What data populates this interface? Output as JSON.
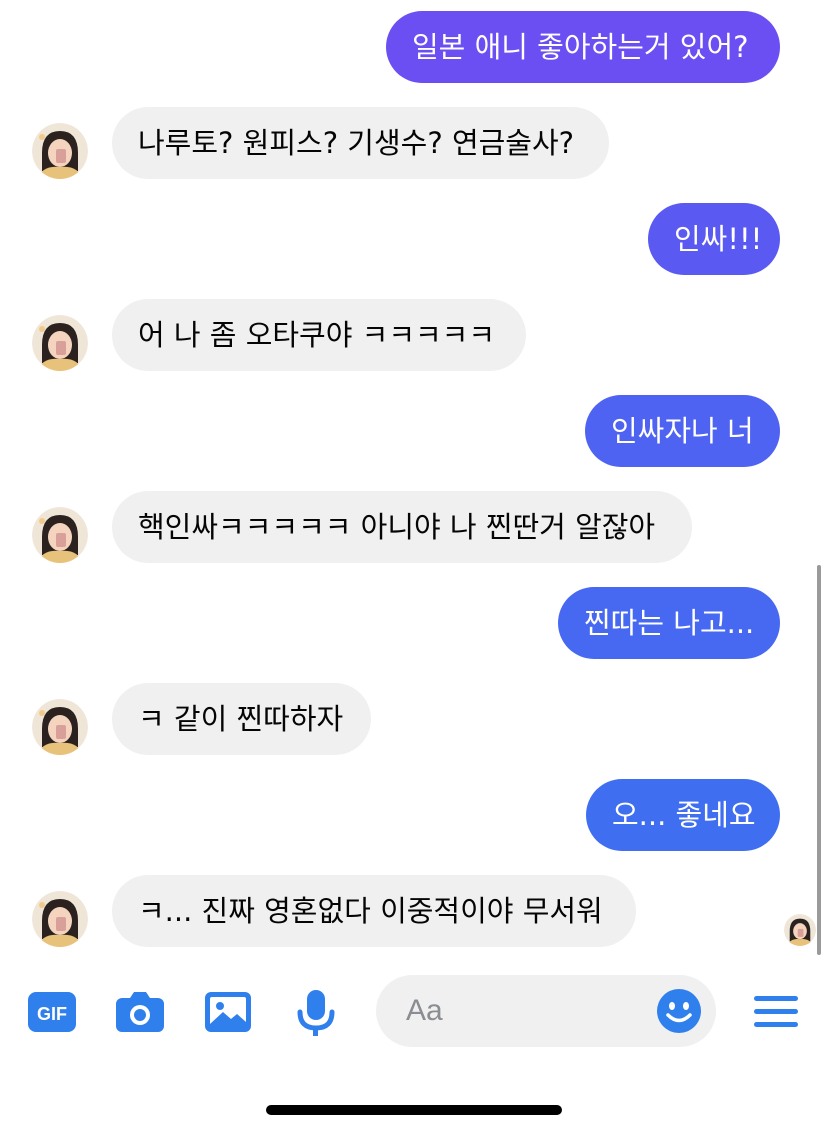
{
  "colors": {
    "outgoing_top": "#6a4df0",
    "outgoing_bottom": "#3f6ff0",
    "incoming_bg": "#f0f0f0",
    "accent": "#2f80ed"
  },
  "messages": [
    {
      "direction": "out",
      "text": "일본 애니 좋아하는거 있어?",
      "color": "#6b4ff2"
    },
    {
      "direction": "in",
      "text": "나루토? 원피스? 기생수? 연금술사?"
    },
    {
      "direction": "out",
      "text": "인싸!!!",
      "color": "#5a5af2"
    },
    {
      "direction": "in",
      "text": "어 나 좀 오타쿠야 ㅋㅋㅋㅋㅋ"
    },
    {
      "direction": "out",
      "text": "인싸자나 너",
      "color": "#4f63f2"
    },
    {
      "direction": "in",
      "text": "핵인싸ㅋㅋㅋㅋㅋ 아니야 나 찐딴거 알잖아"
    },
    {
      "direction": "out",
      "text": "찐따는 나고...",
      "color": "#4769f2"
    },
    {
      "direction": "in",
      "text": "ㅋ 같이 찐따하자"
    },
    {
      "direction": "out",
      "text": "오... 좋네요",
      "color": "#3f6ff0"
    },
    {
      "direction": "in",
      "text": "ㅋ... 진짜 영혼없다 이중적이야 무서워"
    }
  ],
  "composer": {
    "icons": [
      "gif-icon",
      "camera-icon",
      "image-icon",
      "microphone-icon",
      "emoji-icon",
      "menu-icon"
    ],
    "gif_label": "GIF",
    "placeholder": "Aa"
  }
}
